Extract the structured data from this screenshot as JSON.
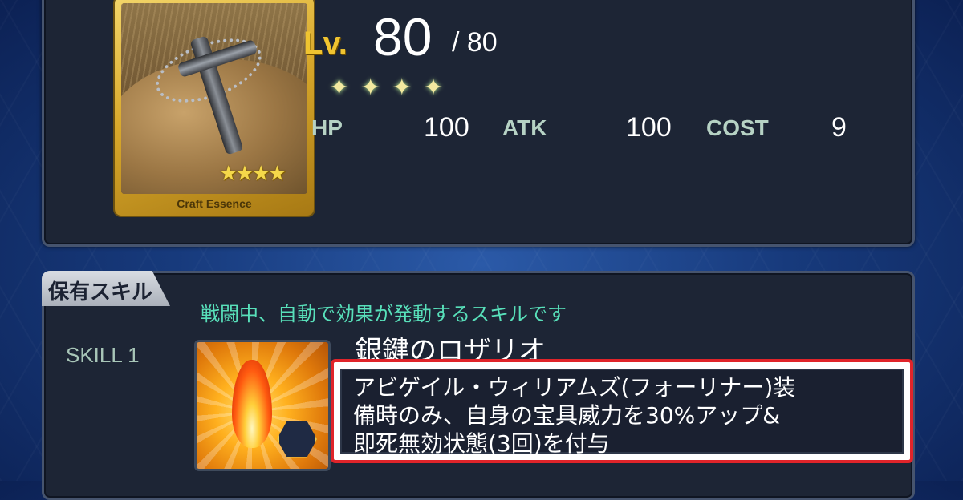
{
  "card": {
    "type_label": "Craft Essence",
    "rarity_stars": 4,
    "stars_text": "★★★★",
    "illustration": "silver rosary cross on rock"
  },
  "level": {
    "label": "Lv.",
    "current": "80",
    "max": "/ 80"
  },
  "rarity_row": "✦✦✦✦",
  "stats": {
    "hp_label": "HP",
    "hp_value": "100",
    "atk_label": "ATK",
    "atk_value": "100",
    "cost_label": "COST",
    "cost_value": "9"
  },
  "skills": {
    "tab_label": "保有スキル",
    "header_text": "戦闘中、自動で効果が発動するスキルです",
    "skill1": {
      "slot_label": "SKILL 1",
      "icon": "flame-buff-icon",
      "name": "銀鍵のロザリオ",
      "effect_lines": [
        "アビゲイル・ウィリアムズ(フォーリナー)装",
        "備時のみ、自身の宝具威力を30%アップ&",
        "即死無効状態(3回)を付与"
      ]
    }
  },
  "colors": {
    "highlight": "#e0242a",
    "gold": "#f0c430",
    "teal_text": "#58e0ba"
  }
}
